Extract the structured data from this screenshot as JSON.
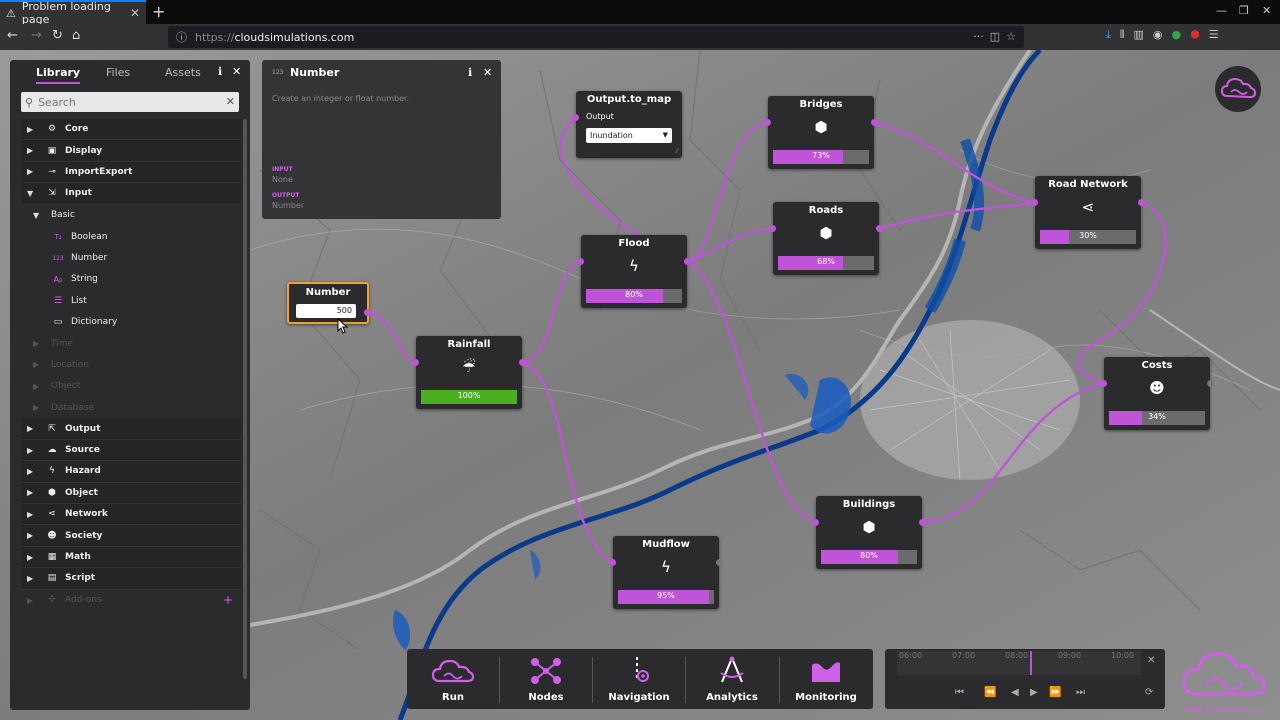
{
  "browser": {
    "tab_title": "Problem loading page",
    "tab_close": "✕",
    "new_tab": "+",
    "url_scheme": "https://",
    "url_host": "cloudsimulations.com"
  },
  "library": {
    "tabs": [
      "Library",
      "Files",
      "Assets"
    ],
    "search_placeholder": "Search",
    "items": [
      {
        "label": "Core",
        "type": "cat"
      },
      {
        "label": "Display",
        "type": "cat"
      },
      {
        "label": "ImportExport",
        "type": "cat"
      },
      {
        "label": "Input",
        "type": "cat-open"
      },
      {
        "label": "Basic",
        "type": "group"
      },
      {
        "label": "Boolean",
        "type": "sub",
        "icon": "T₂"
      },
      {
        "label": "Number",
        "type": "sub",
        "icon": "123"
      },
      {
        "label": "String",
        "type": "sub",
        "icon": "Aᵦ"
      },
      {
        "label": "List",
        "type": "sub",
        "icon": "☰"
      },
      {
        "label": "Dictionary",
        "type": "sub",
        "icon": "▭"
      },
      {
        "label": "Time",
        "type": "dim"
      },
      {
        "label": "Location",
        "type": "dim"
      },
      {
        "label": "Object",
        "type": "dim"
      },
      {
        "label": "Database",
        "type": "dim"
      },
      {
        "label": "Output",
        "type": "cat"
      },
      {
        "label": "Source",
        "type": "cat"
      },
      {
        "label": "Hazard",
        "type": "cat"
      },
      {
        "label": "Object",
        "type": "cat"
      },
      {
        "label": "Network",
        "type": "cat"
      },
      {
        "label": "Society",
        "type": "cat"
      },
      {
        "label": "Math",
        "type": "cat"
      },
      {
        "label": "Script",
        "type": "cat"
      },
      {
        "label": "Add-ons",
        "type": "addon"
      }
    ]
  },
  "info_panel": {
    "badge": "123",
    "title": "Number",
    "description": "Create an integer or float number.",
    "input_heading": "INPUT",
    "input_value": "None",
    "output_heading": "OUTPUT",
    "output_value": "Number"
  },
  "nodes": {
    "number": {
      "title": "Number",
      "value": "500"
    },
    "rainfall": {
      "title": "Rainfall",
      "progress": 100,
      "progress_label": "100%"
    },
    "flood": {
      "title": "Flood",
      "progress": 80,
      "progress_label": "80%"
    },
    "output_to_map": {
      "title": "Output.to_map",
      "field_label": "Output",
      "select_value": "Inundation"
    },
    "bridges": {
      "title": "Bridges",
      "progress": 73,
      "progress_label": "73%"
    },
    "roads": {
      "title": "Roads",
      "progress": 68,
      "progress_label": "68%"
    },
    "road_network": {
      "title": "Road Network",
      "progress": 30,
      "progress_label": "30%"
    },
    "costs": {
      "title": "Costs",
      "progress": 34,
      "progress_label": "34%"
    },
    "buildings": {
      "title": "Buildings",
      "progress": 80,
      "progress_label": "80%"
    },
    "mudflow": {
      "title": "Mudflow",
      "progress": 95,
      "progress_label": "95%"
    }
  },
  "dock": {
    "run": "Run",
    "nodes": "Nodes",
    "navigation": "Navigation",
    "analytics": "Analytics",
    "monitoring": "Monitoring"
  },
  "timeline": {
    "ticks": [
      "06:00",
      "07:00",
      "08:00",
      "09:00",
      "10:00"
    ],
    "close": "✕"
  },
  "brand": {
    "text": "cloud simulations"
  },
  "colors": {
    "accent": "#c054d8",
    "progress_done": "#4caf20",
    "water": "#0a3a8a"
  }
}
